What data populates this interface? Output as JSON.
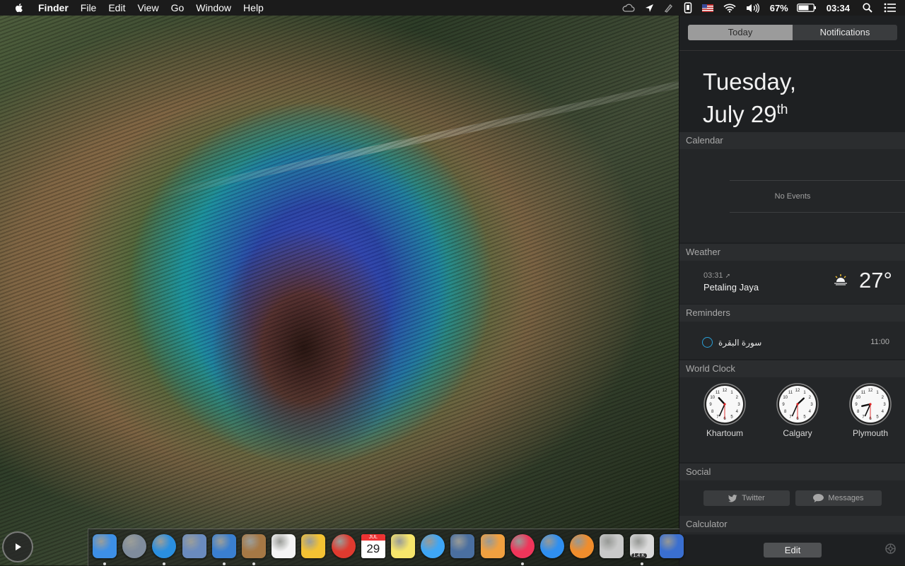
{
  "menubar": {
    "app_name": "Finder",
    "menus": [
      "File",
      "Edit",
      "View",
      "Go",
      "Window",
      "Help"
    ],
    "battery_percent": "67%",
    "clock": "03:34"
  },
  "notification_center": {
    "tabs": {
      "today": "Today",
      "notifications": "Notifications",
      "active": "Today"
    },
    "date": {
      "line1": "Tuesday,",
      "line2_main": "July 29",
      "line2_suffix": "th"
    },
    "calendar": {
      "title": "Calendar",
      "empty_text": "No Events"
    },
    "weather": {
      "title": "Weather",
      "time": "03:31",
      "city": "Petaling Jaya",
      "temperature": "27°",
      "icon": "sunrise-icon"
    },
    "reminders": {
      "title": "Reminders",
      "items": [
        {
          "text": "سورة البقرة",
          "time": "11:00"
        }
      ]
    },
    "world_clock": {
      "title": "World Clock",
      "clocks": [
        {
          "city": "Khartoum",
          "hour": 10,
          "minute": 34,
          "second": 30
        },
        {
          "city": "Calgary",
          "hour": 1,
          "minute": 34,
          "second": 30
        },
        {
          "city": "Plymouth",
          "hour": 8,
          "minute": 34,
          "second": 30
        }
      ]
    },
    "social": {
      "title": "Social",
      "twitter_label": "Twitter",
      "messages_label": "Messages"
    },
    "calculator": {
      "title": "Calculator"
    },
    "edit_label": "Edit"
  },
  "dock": {
    "apps": [
      {
        "name": "finder",
        "color": "#3d8fe6",
        "running": true
      },
      {
        "name": "launchpad",
        "color": "#7f8c9c",
        "running": false
      },
      {
        "name": "safari",
        "color": "#2a8fe0",
        "running": true
      },
      {
        "name": "mail-stamp",
        "color": "#6a8bbf",
        "running": false
      },
      {
        "name": "twitterrific-bird",
        "color": "#3a7fd0",
        "running": true
      },
      {
        "name": "archive-box",
        "color": "#a67845",
        "running": true
      },
      {
        "name": "instapaper",
        "color": "#f4f4f4",
        "running": false
      },
      {
        "name": "paperclip",
        "color": "#f3c233",
        "running": false
      },
      {
        "name": "youtube-player",
        "color": "#e03a2f",
        "running": false
      },
      {
        "name": "calendar",
        "color": "#ffffff",
        "running": false,
        "month": "JUL",
        "day": "29"
      },
      {
        "name": "notes",
        "color": "#f6e56b",
        "running": false
      },
      {
        "name": "messages",
        "color": "#3ea6f5",
        "running": false
      },
      {
        "name": "image-capture",
        "color": "#4a6fa0",
        "running": false
      },
      {
        "name": "text-edit",
        "color": "#f0a040",
        "running": false
      },
      {
        "name": "itunes",
        "color": "#f0355a",
        "running": true
      },
      {
        "name": "app-store",
        "color": "#2f8ff0",
        "running": false
      },
      {
        "name": "ibooks",
        "color": "#f08d2c",
        "running": false
      },
      {
        "name": "photo-booth",
        "color": "#c9c9c9",
        "running": false
      },
      {
        "name": "transmission",
        "color": "#d9d9d9",
        "running": true,
        "badge": "1.4 K"
      },
      {
        "name": "keynote",
        "color": "#3a6fd0",
        "running": false
      }
    ]
  }
}
